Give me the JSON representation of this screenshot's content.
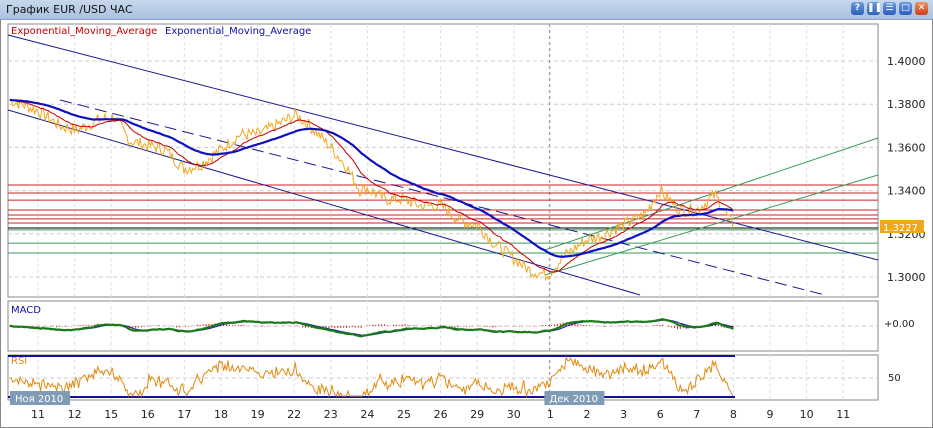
{
  "window": {
    "title": "График EUR /USD  ЧАС",
    "buttons": [
      "?",
      "❚❚",
      "☰",
      "□",
      "✕"
    ]
  },
  "legend": {
    "ema1": "Exponential_Moving_Average",
    "ema2": "Exponential_Moving_Average",
    "ema1_color": "#c00000",
    "ema2_color": "#1010a0"
  },
  "current_price": "1.3227",
  "chart_data": {
    "type": "line",
    "title": "EUR/USD H1",
    "y_ticks": [
      "1.4000",
      "1.3800",
      "1.3600",
      "1.3400",
      "1.3200",
      "1.3000"
    ],
    "y_tick_values": [
      1.4,
      1.38,
      1.36,
      1.34,
      1.32,
      1.3
    ],
    "ylim": [
      1.283,
      1.4155
    ],
    "x_ticks": [
      "11",
      "12",
      "15",
      "16",
      "17",
      "18",
      "19",
      "22",
      "23",
      "24",
      "25",
      "26",
      "29",
      "30",
      "1",
      "2",
      "3",
      "6",
      "7",
      "8",
      "9",
      "10",
      "11"
    ],
    "month_labels": [
      {
        "text": "Ноя 2010",
        "at": 0
      },
      {
        "text": "Дек 2010",
        "at": 14
      }
    ],
    "price": [
      [
        -0.77,
        1.382
      ],
      [
        0,
        1.377
      ],
      [
        0.6,
        1.37
      ],
      [
        1.07,
        1.368
      ],
      [
        1.69,
        1.373
      ],
      [
        2.08,
        1.374
      ],
      [
        2.51,
        1.363
      ],
      [
        2.98,
        1.361
      ],
      [
        3.47,
        1.359
      ],
      [
        3.99,
        1.35
      ],
      [
        4.43,
        1.352
      ],
      [
        5.0,
        1.359
      ],
      [
        5.52,
        1.366
      ],
      [
        6.01,
        1.366
      ],
      [
        6.48,
        1.37
      ],
      [
        7.05,
        1.375
      ],
      [
        7.43,
        1.37
      ],
      [
        7.95,
        1.361
      ],
      [
        8.39,
        1.352
      ],
      [
        8.8,
        1.34
      ],
      [
        8.99,
        1.341
      ],
      [
        9.48,
        1.336
      ],
      [
        10,
        1.336
      ],
      [
        10.44,
        1.333
      ],
      [
        11.01,
        1.333
      ],
      [
        11.53,
        1.326
      ],
      [
        12.02,
        1.324
      ],
      [
        12.49,
        1.315
      ],
      [
        12.9,
        1.31
      ],
      [
        13.44,
        1.303
      ],
      [
        13.93,
        1.301
      ],
      [
        14.4,
        1.31
      ],
      [
        14.97,
        1.317
      ],
      [
        15.36,
        1.319
      ],
      [
        15.98,
        1.324
      ],
      [
        16.58,
        1.329
      ],
      [
        16.99,
        1.34
      ],
      [
        17.54,
        1.331
      ],
      [
        18.0,
        1.331
      ],
      [
        18.5,
        1.338
      ],
      [
        19.02,
        1.3227
      ]
    ],
    "horizontal_levels_red": [
      1.3426,
      1.3389,
      1.3356,
      1.331,
      1.3287,
      1.3269,
      1.325
    ],
    "horizontal_levels_green": [
      1.3218,
      1.3157,
      1.3111
    ],
    "macd": {
      "label": "MACD",
      "zero_label": "+0.00"
    },
    "rsi": {
      "label": "RSI",
      "mid_label": "50"
    }
  }
}
